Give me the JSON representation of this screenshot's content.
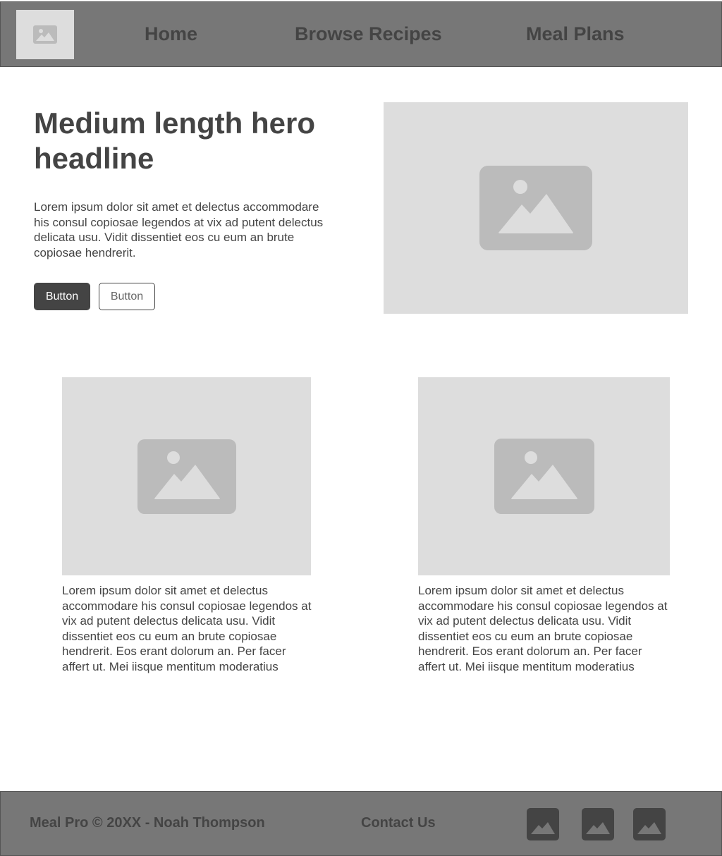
{
  "header": {
    "logo_icon": "image-placeholder-icon",
    "nav": [
      {
        "label": "Home"
      },
      {
        "label": "Browse Recipes"
      },
      {
        "label": "Meal Plans"
      }
    ]
  },
  "hero": {
    "title": "Medium length hero headline",
    "body": "Lorem ipsum dolor sit amet et delectus accommodare his consul copiosae legendos at vix ad putent delectus delicata usu. Vidit dissentiet eos cu eum an brute copiosae hendrerit.",
    "primary_button": "Button",
    "secondary_button": "Button",
    "image_icon": "image-placeholder-icon"
  },
  "cards": [
    {
      "image_icon": "image-placeholder-icon",
      "text": "Lorem ipsum dolor sit amet et delectus accommodare his consul copiosae legendos at vix ad putent delectus delicata usu. Vidit dissentiet eos cu eum an brute copiosae hendrerit. Eos erant dolorum an. Per facer affert ut. Mei iisque mentitum moderatius"
    },
    {
      "image_icon": "image-placeholder-icon",
      "text": "Lorem ipsum dolor sit amet et delectus accommodare his consul copiosae legendos at vix ad putent delectus delicata usu. Vidit dissentiet eos cu eum an brute copiosae hendrerit. Eos erant dolorum an. Per facer affert ut. Mei iisque mentitum moderatius"
    }
  ],
  "footer": {
    "copyright": "Meal Pro © 20XX - Noah Thompson",
    "contact": "Contact Us",
    "social_icons": [
      "image-icon",
      "image-icon",
      "image-icon"
    ]
  },
  "colors": {
    "bar_background": "#777777",
    "placeholder_background": "#dddddd",
    "placeholder_icon": "#bbbbbb",
    "text": "#444444"
  }
}
